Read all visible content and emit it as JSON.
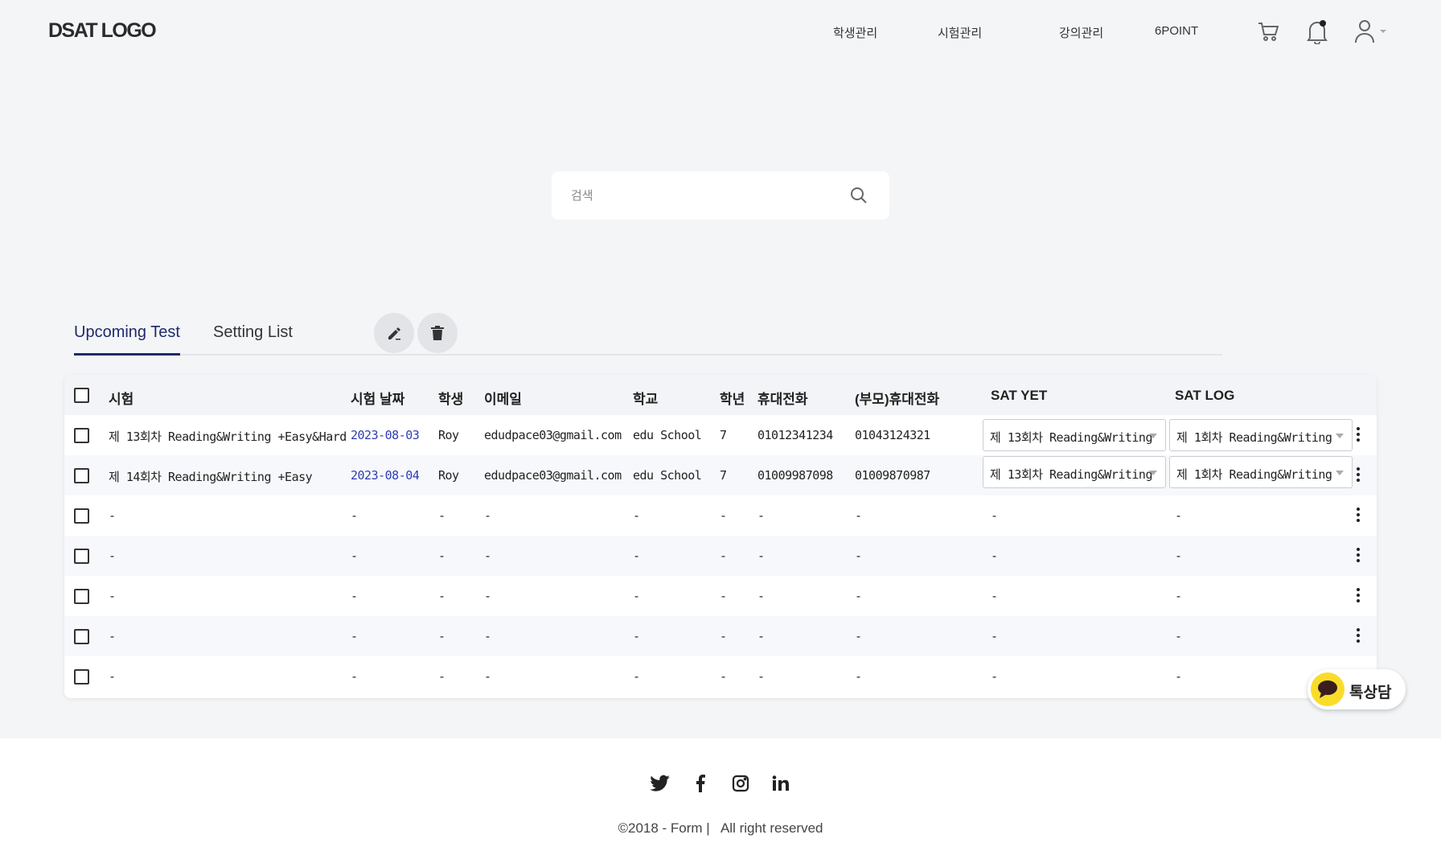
{
  "header": {
    "logo": "DSAT LOGO",
    "nav": [
      "학생관리",
      "시험관리",
      "강의관리",
      "6POINT"
    ],
    "icons": [
      "cart-icon",
      "bell-icon",
      "user-icon"
    ]
  },
  "search": {
    "placeholder": "검색",
    "value": ""
  },
  "tabs": {
    "items": [
      "Upcoming Test",
      "Setting List"
    ],
    "active": "Upcoming Test"
  },
  "table": {
    "columns": [
      "시험",
      "시험 날짜",
      "학생",
      "이메일",
      "학교",
      "학년",
      "휴대전화",
      "(부모)휴대전화",
      "SAT YET",
      "SAT LOG"
    ],
    "rows": [
      {
        "exam": "제 13회차 Reading&Writing +Easy&Hard",
        "date": "2023-08-03",
        "student": "Roy",
        "email": "edudpace03@gmail.com",
        "school": "edu School",
        "grade": "7",
        "phone": "01012341234",
        "parent_phone": "01043124321",
        "sat_yet": "제 13회차 Reading&Writing",
        "sat_log": "제 1회차 Reading&Writing"
      },
      {
        "exam": "제 14회차 Reading&Writing +Easy",
        "date": "2023-08-04",
        "student": "Roy",
        "email": "edudpace03@gmail.com",
        "school": "edu School",
        "grade": "7",
        "phone": "01009987098",
        "parent_phone": "01009870987",
        "sat_yet": "제 13회차 Reading&Writing",
        "sat_log": "제 1회차 Reading&Writing"
      },
      {
        "exam": "-",
        "date": "-",
        "student": "-",
        "email": "-",
        "school": "-",
        "grade": "-",
        "phone": "-",
        "parent_phone": "-",
        "sat_yet": "-",
        "sat_log": "-"
      },
      {
        "exam": "-",
        "date": "-",
        "student": "-",
        "email": "-",
        "school": "-",
        "grade": "-",
        "phone": "-",
        "parent_phone": "-",
        "sat_yet": "-",
        "sat_log": "-"
      },
      {
        "exam": "-",
        "date": "-",
        "student": "-",
        "email": "-",
        "school": "-",
        "grade": "-",
        "phone": "-",
        "parent_phone": "-",
        "sat_yet": "-",
        "sat_log": "-"
      },
      {
        "exam": "-",
        "date": "-",
        "student": "-",
        "email": "-",
        "school": "-",
        "grade": "-",
        "phone": "-",
        "parent_phone": "-",
        "sat_yet": "-",
        "sat_log": "-"
      },
      {
        "exam": "-",
        "date": "-",
        "student": "-",
        "email": "-",
        "school": "-",
        "grade": "-",
        "phone": "-",
        "parent_phone": "-",
        "sat_yet": "-",
        "sat_log": "-"
      }
    ]
  },
  "chat": {
    "label": "톡상담"
  },
  "footer": {
    "copyright": "©2018 - Form |   All right reserved",
    "social": [
      "twitter-icon",
      "facebook-icon",
      "instagram-icon",
      "linkedin-icon"
    ]
  },
  "colors": {
    "accent": "#1f2a6b",
    "date": "#2f3cb3",
    "chat": "#f9dc2b"
  }
}
